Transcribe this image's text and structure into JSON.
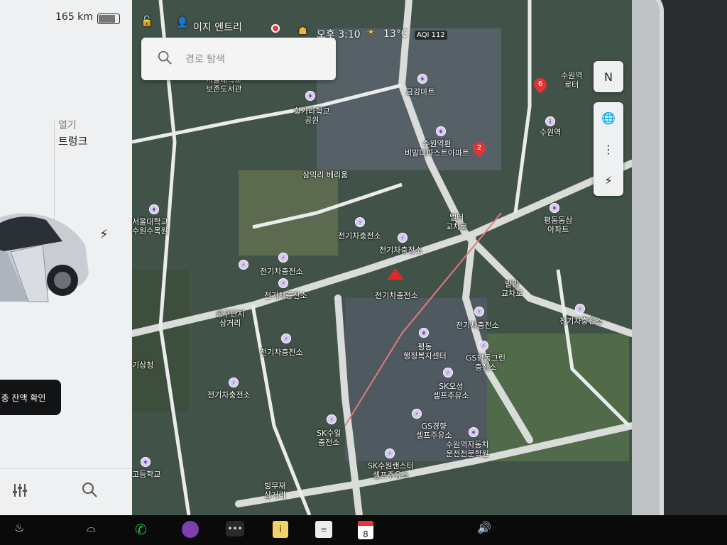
{
  "status_bar": {
    "range": "165 km",
    "battery_fraction": 0.75,
    "profile_name": "이지 엔트리",
    "time": "오후 3:10",
    "temperature": "13°C",
    "aqi": "AQI 112"
  },
  "left_panel": {
    "open_label": "열기",
    "trunk_label": "트렁크",
    "check_button_label": "충 잔액 확인"
  },
  "search": {
    "placeholder": "경로 탐색"
  },
  "map_labels": [
    {
      "text": "서울대학교\n보존도서관"
    },
    {
      "text": "항가라학교\n공원"
    },
    {
      "text": "금강마트"
    },
    {
      "text": "수원역환 \n비발디파스트아파트"
    },
    {
      "text": "수원역"
    },
    {
      "text": "삼익리 베리움"
    },
    {
      "text": "서울대학교\n수원수목원"
    },
    {
      "text": "전기차충전소"
    },
    {
      "text": "전기차충전소"
    },
    {
      "text": "전기차충전소"
    },
    {
      "text": "전기차충전소"
    },
    {
      "text": "벌터\n교차로"
    },
    {
      "text": "평동동삼\n아파트"
    },
    {
      "text": "공구단지\n삼거리"
    },
    {
      "text": "전기차충전소"
    },
    {
      "text": "전기차충전소"
    },
    {
      "text": "발말\n교차로"
    },
    {
      "text": "전기차충전소"
    },
    {
      "text": "전기차충전소"
    },
    {
      "text": "평동\n행정복지센터"
    },
    {
      "text": "GS평동그린\n충전소"
    },
    {
      "text": "기상청"
    },
    {
      "text": "전기차충전소"
    },
    {
      "text": "SK오성\n셀프주유소"
    },
    {
      "text": "GS경향\n셀프주유소"
    },
    {
      "text": "SK수일\n충전소"
    },
    {
      "text": "수원역자동차\n운전전문학원"
    },
    {
      "text": "SK수원랜스터\n셀프주유소"
    },
    {
      "text": "고등학교"
    },
    {
      "text": "빙무재\n삼거리"
    },
    {
      "text": "수원역\n로터"
    }
  ],
  "charger_badges": [
    "6",
    "2"
  ],
  "map_controls": [
    "N",
    "globe",
    "traffic",
    "charging"
  ],
  "taskbar": {
    "calendar_day": "8"
  },
  "colors": {
    "accent_red": "#e02a2a",
    "panel_bg": "#eef0f1"
  }
}
